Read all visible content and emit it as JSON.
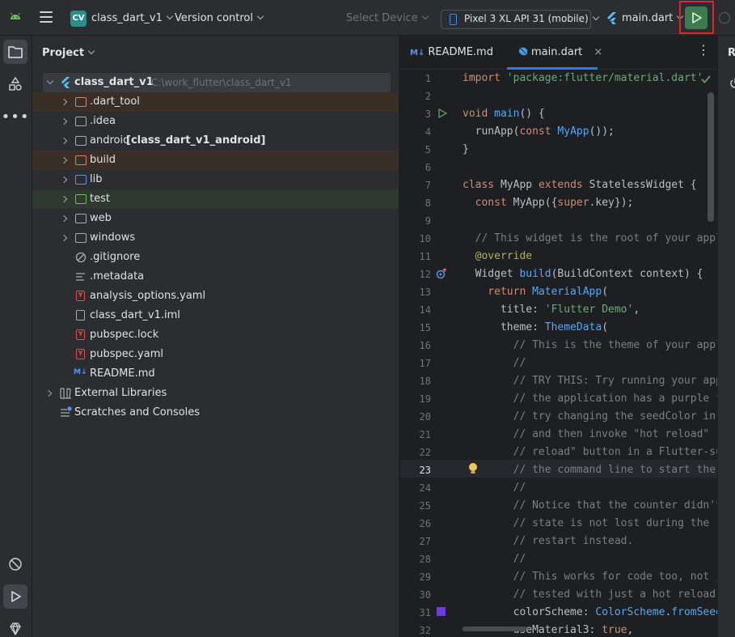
{
  "toolbar": {
    "project_badge": "CV",
    "project_name": "class_dart_v1",
    "vcs_label": "Version control",
    "select_device": "Select Device",
    "device": "Pixel 3 XL API 31 (mobile)",
    "run_config": "main.dart"
  },
  "project_panel": {
    "title": "Project",
    "root": {
      "name": "class_dart_v1",
      "path": "C:\\work_flutter\\class_dart_v1"
    },
    "items": [
      {
        "label": ".dart_tool"
      },
      {
        "label": ".idea"
      },
      {
        "label": "android",
        "module": "[class_dart_v1_android]"
      },
      {
        "label": "build"
      },
      {
        "label": "lib"
      },
      {
        "label": "test"
      },
      {
        "label": "web"
      },
      {
        "label": "windows"
      },
      {
        "label": ".gitignore"
      },
      {
        "label": ".metadata"
      },
      {
        "label": "analysis_options.yaml"
      },
      {
        "label": "class_dart_v1.iml"
      },
      {
        "label": "pubspec.lock"
      },
      {
        "label": "pubspec.yaml"
      },
      {
        "label": "README.md"
      }
    ],
    "external_libraries": "External Libraries",
    "scratches": "Scratches and Consoles"
  },
  "editor": {
    "tabs": [
      {
        "label": "README.md",
        "badge": "M↓"
      },
      {
        "label": "main.dart"
      }
    ],
    "current_line": 23,
    "line_numbers": [
      "1",
      "2",
      "3",
      "4",
      "5",
      "6",
      "7",
      "8",
      "9",
      "10",
      "11",
      "12",
      "13",
      "14",
      "15",
      "16",
      "17",
      "18",
      "19",
      "20",
      "21",
      "22",
      "23",
      "24",
      "25",
      "26",
      "27",
      "28",
      "29",
      "30",
      "31",
      "32"
    ]
  },
  "right_panel": {
    "label": "R"
  },
  "colors": {
    "accent": "#3574f0",
    "run_green": "#3d7a4d",
    "highlight_red": "#e0232c",
    "badge_teal": "#2a8f8b"
  }
}
